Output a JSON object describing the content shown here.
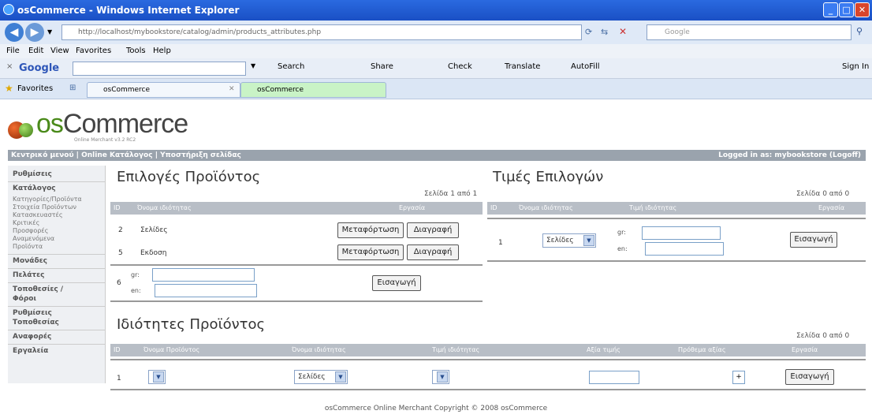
{
  "window": {
    "title": "osCommerce - Windows Internet Explorer",
    "address": "http://localhost/mybookstore/catalog/admin/products_attributes.php",
    "address_host": "localhost",
    "search_placeholder": "Google"
  },
  "menu": [
    "File",
    "Edit",
    "View",
    "Favorites",
    "Tools",
    "Help"
  ],
  "google_toolbar": {
    "close": "×",
    "logo": "Google",
    "search": "Search",
    "share": "Share",
    "check": "Check",
    "translate": "Translate",
    "autofill": "AutoFill",
    "signin": "Sign In"
  },
  "favorites": {
    "label": "Favorites",
    "tabs": [
      "osCommerce",
      "osCommerce"
    ]
  },
  "logo": {
    "prefix": "os",
    "word": "Commerce",
    "tagline": "Online Merchant v3.2 RC2"
  },
  "header": {
    "left": "Κεντρικό μενού  |  Online Κατάλογος  |  Υποστήριξη σελίδας",
    "right": "Logged in as: mybookstore (Logoff)"
  },
  "sidebar": {
    "settings": "Ρυθμίσεις",
    "catalog": "Κατάλογος",
    "catalog_items": [
      "Κατηγορίες/Προϊόντα",
      "Στοιχεία Προϊόντων",
      "Κατασκευαστές",
      "Κριτικές",
      "Προσφορές",
      "Αναμενόμενα",
      "Προϊόντα"
    ],
    "modules": "Μονάδες",
    "customers": "Πελάτες",
    "locations": "Τοποθεσίες /",
    "locations2": "Φόροι",
    "loc_settings": "Ρυθμίσεις",
    "loc_settings2": "Τοποθεσίας",
    "reports": "Αναφορές",
    "tools": "Εργαλεία"
  },
  "options": {
    "title": "Επιλογές Προϊόντος",
    "page": "Σελίδα 1 από 1",
    "headers": [
      "ID",
      "Όνομα ιδιότητας",
      "Εργασία"
    ],
    "rows": [
      {
        "id": "2",
        "name": "Σελίδες"
      },
      {
        "id": "5",
        "name": "Εκδοση"
      }
    ],
    "edit_label": "Μεταφόρτωση",
    "delete_label": "Διαγραφή",
    "new_id": "6",
    "gr": "gr:",
    "en": "en:",
    "insert_label": "Εισαγωγή"
  },
  "values": {
    "title": "Τιμές Επιλογών",
    "page": "Σελίδα 0 από 0",
    "headers": [
      "ID",
      "Όνομα ιδιότητας",
      "Τιμή ιδιότητας",
      "Εργασία"
    ],
    "new_id": "1",
    "option_selected": "Σελίδες",
    "gr": "gr:",
    "en": "en:",
    "insert_label": "Εισαγωγή"
  },
  "attributes": {
    "title": "Ιδιότητες Προϊόντος",
    "page": "Σελίδα 0 από 0",
    "headers": [
      "ID",
      "Όνομα Προϊόντος",
      "Όνομα ιδιότητας",
      "Τιμή ιδιότητας",
      "Αξία τιμής",
      "Πρόθεμα αξίας",
      "Εργασία"
    ],
    "new_id": "1",
    "option_selected": "Σελίδες",
    "prefix_value": "+",
    "insert_label": "Εισαγωγή"
  },
  "footer": "osCommerce Online Merchant Copyright © 2008 osCommerce"
}
